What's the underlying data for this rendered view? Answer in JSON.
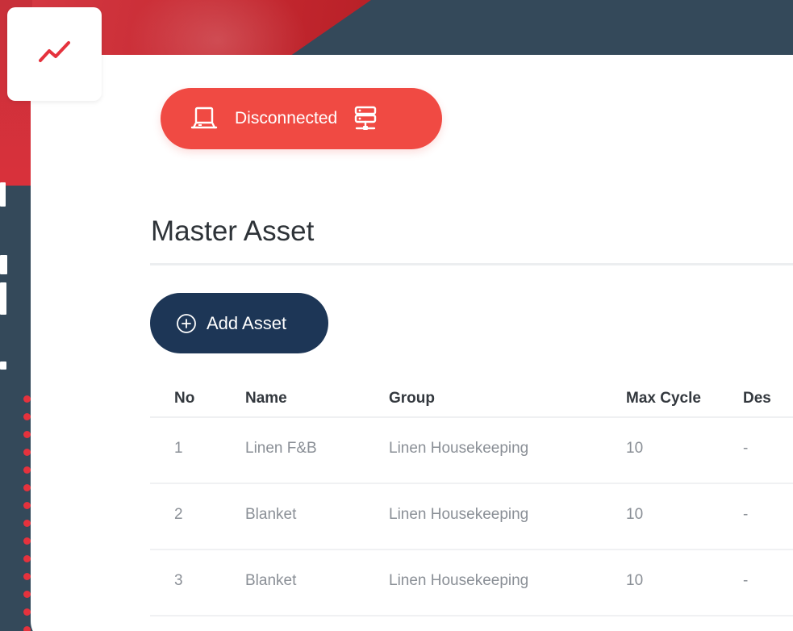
{
  "status": {
    "label": "Disconnected",
    "color": "#f04a43"
  },
  "page_title": "Master Asset",
  "actions": {
    "add_label": "Add Asset"
  },
  "table": {
    "columns": [
      "No",
      "Name",
      "Group",
      "Max Cycle",
      "Des"
    ],
    "rows": [
      [
        "1",
        "Linen F&B",
        "Linen Housekeeping",
        "10",
        "-"
      ],
      [
        "2",
        "Blanket",
        "Linen Housekeeping",
        "10",
        "-"
      ],
      [
        "3",
        "Blanket",
        "Linen Housekeeping",
        "10",
        "-"
      ]
    ]
  },
  "icons": {
    "logo": "trend-line-icon",
    "status_lead": "laptop-icon",
    "status_tail": "server-network-icon",
    "add": "plus-circle-icon"
  },
  "colors": {
    "brand_red": "#e5323d",
    "navy": "#1d3656",
    "slate": "#34495a"
  }
}
